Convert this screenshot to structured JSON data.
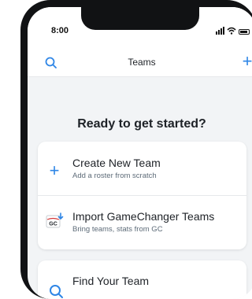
{
  "status_bar": {
    "time": "8:00"
  },
  "nav": {
    "title": "Teams"
  },
  "main": {
    "heading": "Ready to get started?",
    "options": [
      {
        "title": "Create New Team",
        "subtitle": "Add a roster from scratch",
        "icon": "plus-icon"
      },
      {
        "title": "Import GameChanger Teams",
        "subtitle": "Bring teams, stats from GC",
        "icon": "gamechanger-logo-icon"
      },
      {
        "title": "Find Your Team",
        "subtitle": "",
        "icon": "search-icon"
      }
    ]
  },
  "colors": {
    "accent": "#2f86e6",
    "background": "#f2f4f6",
    "card": "#ffffff"
  }
}
